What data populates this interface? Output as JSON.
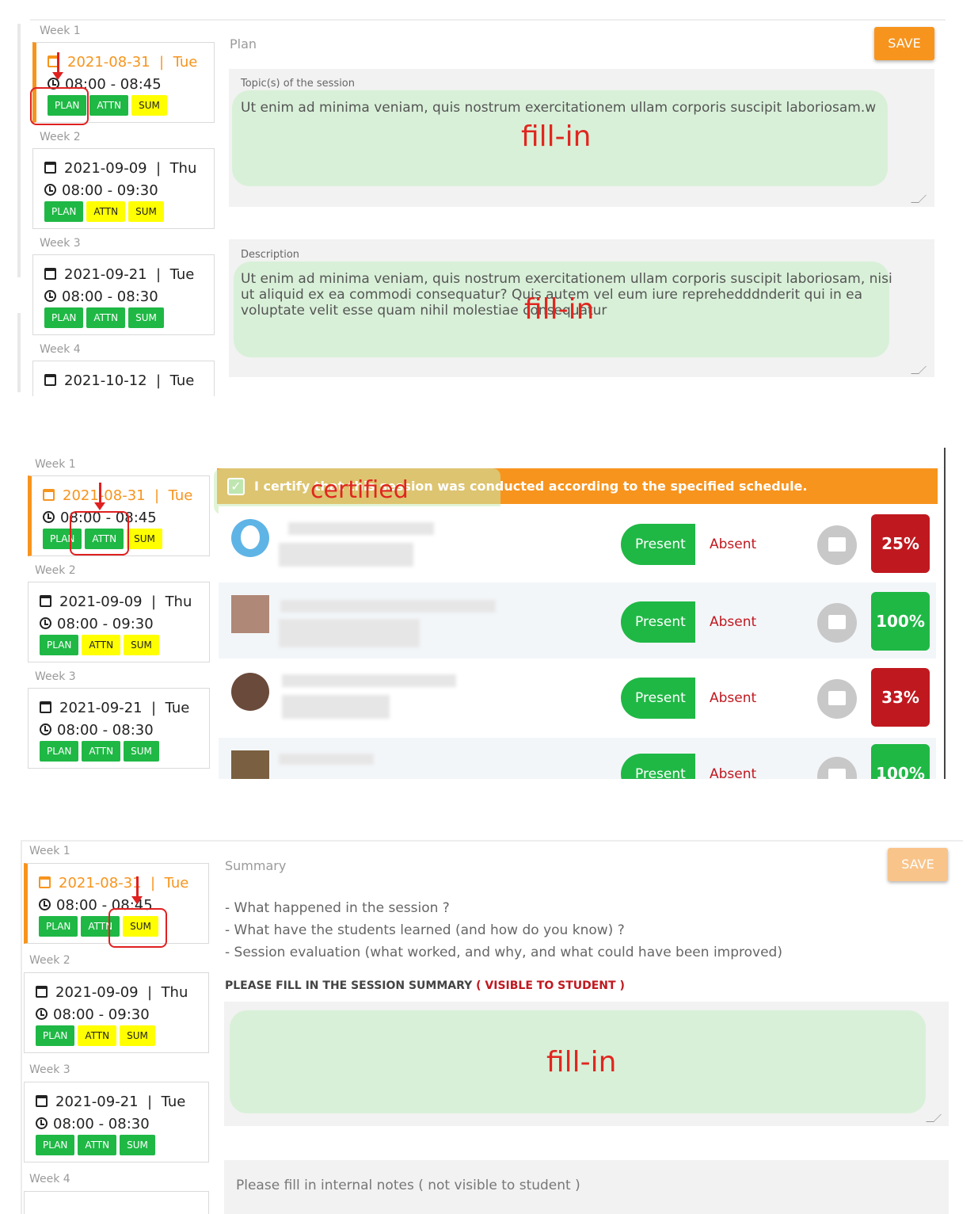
{
  "sidebar": {
    "weeks": [
      "Week 1",
      "Week 2",
      "Week 3",
      "Week 4"
    ],
    "sessions": [
      {
        "date": "2021-08-31",
        "day": "Tue",
        "time": "08:00 - 08:45"
      },
      {
        "date": "2021-09-09",
        "day": "Thu",
        "time": "08:00 - 09:30"
      },
      {
        "date": "2021-09-21",
        "day": "Tue",
        "time": "08:00 - 08:30"
      },
      {
        "date": "2021-10-12",
        "day": "Tue",
        "time": ""
      }
    ],
    "buttons": {
      "plan": "PLAN",
      "attn": "ATTN",
      "sum": "SUM"
    }
  },
  "plan": {
    "section_label": "Plan",
    "save_label": "SAVE",
    "topic_label": "Topic(s) of the session",
    "topic_value": "Ut enim ad minima veniam, quis nostrum exercitationem ullam corporis suscipit laboriosam.w",
    "description_label": "Description",
    "description_value": "Ut enim ad minima veniam, quis nostrum exercitationem ullam corporis suscipit laboriosam, nisi ut aliquid ex ea commodi consequatur? Quis autem vel eum iure reprehedddnderit qui in ea voluptate velit esse quam nihil molestiae consequatur",
    "fill_in_note": "fill-in"
  },
  "attendance": {
    "certify_text": "I certify that this session was conducted according to the specified schedule.",
    "certified_note": "certified",
    "present_label": "Present",
    "absent_label": "Absent",
    "students": [
      {
        "percent": "25%",
        "status_color": "#c0181f"
      },
      {
        "percent": "100%",
        "status_color": "#1fb845"
      },
      {
        "percent": "33%",
        "status_color": "#c0181f"
      },
      {
        "percent": "100%",
        "status_color": "#1fb845"
      }
    ]
  },
  "summary": {
    "section_label": "Summary",
    "save_label": "SAVE",
    "prompts": [
      "- What happened in the session ?",
      "- What have the students learned (and how do you know) ?",
      "- Session evaluation (what worked, and why, and what could have been improved)"
    ],
    "fill_label": "PLEASE FILL IN THE SESSION SUMMARY",
    "fill_label_note": "( VISIBLE TO STUDENT )",
    "fill_in_note": "fill-in",
    "internal_placeholder": "Please fill in internal notes ( not visible to student )"
  },
  "colors": {
    "accent": "#f7941d",
    "green": "#1fb845",
    "yellow": "#ffff00",
    "red": "#c0181f",
    "annotation": "#e0261f"
  }
}
